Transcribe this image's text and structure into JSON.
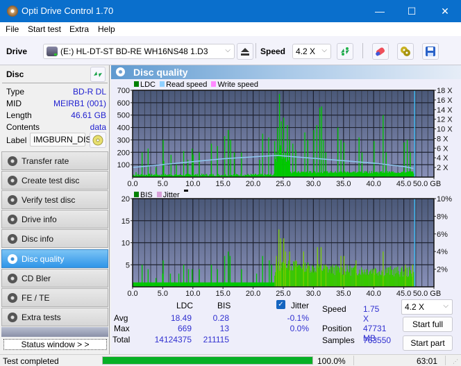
{
  "window": {
    "title": "Opti Drive Control 1.70",
    "minimize": "—",
    "maximize": "☐",
    "close": "✕"
  },
  "menu": [
    "File",
    "Start test",
    "Extra",
    "Help"
  ],
  "toolbar": {
    "drive_label": "Drive",
    "drive_value": "(E:)  HL-DT-ST BD-RE  WH16NS48 1.D3",
    "speed_label": "Speed",
    "speed_value": "4.2 X",
    "icons": [
      "eject-icon",
      "refresh-icon",
      "eraser-icon",
      "copy-icon",
      "save-icon"
    ]
  },
  "disc": {
    "header": "Disc",
    "rows": [
      {
        "key": "Type",
        "value": "BD-R DL"
      },
      {
        "key": "MID",
        "value": "MEIRB1 (001)"
      },
      {
        "key": "Length",
        "value": "46.61 GB"
      },
      {
        "key": "Contents",
        "value": "data"
      }
    ],
    "label_key": "Label",
    "label_value": "IMGBURN_DIS"
  },
  "nav": [
    {
      "label": "Transfer rate",
      "active": false
    },
    {
      "label": "Create test disc",
      "active": false
    },
    {
      "label": "Verify test disc",
      "active": false
    },
    {
      "label": "Drive info",
      "active": false
    },
    {
      "label": "Disc info",
      "active": false
    },
    {
      "label": "Disc quality",
      "active": true
    },
    {
      "label": "CD Bler",
      "active": false
    },
    {
      "label": "FE / TE",
      "active": false
    },
    {
      "label": "Extra tests",
      "active": false
    }
  ],
  "status_window_button": "Status window > >",
  "panel_title": "Disc quality",
  "colors": {
    "ldc": "#00c800",
    "bis": "#00c800",
    "read_speed": "#8fc8f0",
    "write_speed": "#ff66ff",
    "jitter": "#e0a0d8",
    "plot_bg_top": "#4a5878",
    "plot_bg_bottom": "#8890b8",
    "accent": "#0a6fcc"
  },
  "chart_data": [
    {
      "type": "bar",
      "title": "LDC / Read speed",
      "legend": [
        "LDC",
        "Read speed",
        "Write speed"
      ],
      "legend_position": "top-left",
      "xlabel": "GB",
      "x_ticks": [
        "0.0",
        "5.0",
        "10.0",
        "15.0",
        "20.0",
        "25.0",
        "30.0",
        "35.0",
        "40.0",
        "45.0",
        "50.0 GB"
      ],
      "xlim": [
        0,
        50
      ],
      "ylim": [
        0,
        700
      ],
      "y_ticks": [
        "100",
        "200",
        "300",
        "400",
        "500",
        "600",
        "700"
      ],
      "y2lim": [
        0,
        18
      ],
      "y2_ticks": [
        "2 X",
        "4 X",
        "6 X",
        "8 X",
        "10 X",
        "12 X",
        "14 X",
        "16 X",
        "18 X"
      ],
      "grid": true,
      "data_end_gb": 46.61,
      "ldc_spikes": [
        [
          0.5,
          40
        ],
        [
          1.5,
          200
        ],
        [
          2.5,
          230
        ],
        [
          3.8,
          80
        ],
        [
          5.0,
          300
        ],
        [
          5.1,
          130
        ],
        [
          6.3,
          180
        ],
        [
          7.2,
          100
        ],
        [
          8.4,
          210
        ],
        [
          9.1,
          140
        ],
        [
          9.8,
          230
        ],
        [
          10.0,
          180
        ],
        [
          11.0,
          200
        ],
        [
          13.0,
          270
        ],
        [
          14.0,
          250
        ],
        [
          15.2,
          330
        ],
        [
          15.8,
          380
        ],
        [
          16.2,
          300
        ],
        [
          16.8,
          200
        ],
        [
          18.0,
          200
        ],
        [
          21.0,
          140
        ],
        [
          21.5,
          350
        ],
        [
          22.5,
          320
        ],
        [
          23.5,
          290
        ],
        [
          24.0,
          400
        ],
        [
          24.3,
          670
        ],
        [
          24.6,
          450
        ],
        [
          25.0,
          480
        ],
        [
          25.6,
          420
        ],
        [
          26.0,
          300
        ],
        [
          26.5,
          270
        ],
        [
          27.0,
          220
        ],
        [
          28.5,
          360
        ],
        [
          29.0,
          300
        ],
        [
          30.0,
          380
        ],
        [
          30.5,
          420
        ],
        [
          31.0,
          560
        ],
        [
          31.3,
          570
        ],
        [
          31.6,
          300
        ],
        [
          32.0,
          200
        ],
        [
          34.0,
          400
        ],
        [
          34.5,
          300
        ],
        [
          35.0,
          280
        ],
        [
          37.5,
          320
        ],
        [
          38.0,
          200
        ],
        [
          40.0,
          290
        ],
        [
          41.5,
          500
        ],
        [
          42.0,
          200
        ],
        [
          45.0,
          280
        ],
        [
          45.5,
          300
        ],
        [
          46.0,
          200
        ]
      ],
      "ldc_baseline": 20,
      "read_speed_x": [
        [
          0,
          2.0
        ],
        [
          5,
          2.6
        ],
        [
          10,
          3.2
        ],
        [
          15,
          3.8
        ],
        [
          20,
          4.2
        ],
        [
          24,
          4.5
        ],
        [
          25,
          4.4
        ],
        [
          30,
          3.9
        ],
        [
          35,
          3.4
        ],
        [
          40,
          2.9
        ],
        [
          45,
          2.2
        ],
        [
          46.6,
          1.8
        ]
      ],
      "marker_gb": 46.8
    },
    {
      "type": "bar",
      "title": "BIS / Jitter",
      "legend": [
        "BIS",
        "Jitter"
      ],
      "legend_position": "top-left",
      "xlabel": "GB",
      "x_ticks": [
        "0.0",
        "5.0",
        "10.0",
        "15.0",
        "20.0",
        "25.0",
        "30.0",
        "35.0",
        "40.0",
        "45.0",
        "50.0 GB"
      ],
      "xlim": [
        0,
        50
      ],
      "ylim": [
        0,
        20
      ],
      "y_ticks": [
        "5",
        "10",
        "15",
        "20"
      ],
      "y2lim": [
        0,
        10
      ],
      "y2_ticks": [
        "2%",
        "4%",
        "6%",
        "8%",
        "10%"
      ],
      "grid": true,
      "data_end_gb": 46.61,
      "bis_spikes": [
        [
          1.5,
          5
        ],
        [
          2.5,
          4
        ],
        [
          3.8,
          2
        ],
        [
          5.0,
          6
        ],
        [
          4.9,
          3
        ],
        [
          6.2,
          3
        ],
        [
          7.6,
          3
        ],
        [
          8.4,
          5
        ],
        [
          9.2,
          4
        ],
        [
          9.8,
          4
        ],
        [
          11.0,
          4
        ],
        [
          13.0,
          5
        ],
        [
          14.0,
          4
        ],
        [
          15.2,
          7
        ],
        [
          15.8,
          8
        ],
        [
          16.1,
          7
        ],
        [
          18.0,
          4
        ],
        [
          20.5,
          3
        ],
        [
          21.5,
          7
        ],
        [
          22.6,
          6
        ],
        [
          23.0,
          5
        ],
        [
          23.8,
          7
        ],
        [
          24.2,
          13
        ],
        [
          24.5,
          11
        ],
        [
          25.0,
          11
        ],
        [
          25.3,
          8
        ],
        [
          26.0,
          8
        ],
        [
          27.0,
          6
        ],
        [
          28.3,
          8
        ],
        [
          29.0,
          5
        ],
        [
          30.6,
          9
        ],
        [
          31.2,
          9
        ],
        [
          32.0,
          5
        ],
        [
          34.5,
          7
        ],
        [
          35.0,
          7
        ],
        [
          37.0,
          6
        ],
        [
          40.0,
          4
        ],
        [
          41.5,
          8
        ],
        [
          45.2,
          5
        ],
        [
          46.4,
          5
        ]
      ],
      "bis_level_profile": [
        [
          0,
          1
        ],
        [
          23.5,
          1
        ],
        [
          23.8,
          4
        ],
        [
          28,
          4
        ],
        [
          30,
          3.5
        ],
        [
          35,
          3
        ],
        [
          40,
          3
        ],
        [
          46.61,
          2.5
        ]
      ]
    }
  ],
  "stats": {
    "col_ldc": "LDC",
    "col_bis": "BIS",
    "rows": [
      {
        "label": "Avg",
        "ldc": "18.49",
        "bis": "0.28"
      },
      {
        "label": "Max",
        "ldc": "669",
        "bis": "13"
      },
      {
        "label": "Total",
        "ldc": "14124375",
        "bis": "211115"
      }
    ],
    "jitter_label": "Jitter",
    "jitter_checked": true,
    "jitter_avg": "-0.1%",
    "jitter_max": "0.0%",
    "speed_label": "Speed",
    "speed_value": "1.75 X",
    "position_label": "Position",
    "position_value": "47731 MB",
    "samples_label": "Samples",
    "samples_value": "763550",
    "speed_select": "4.2 X",
    "start_full": "Start full",
    "start_part": "Start part"
  },
  "statusbar": {
    "text": "Test completed",
    "progress_percent": 100.0,
    "progress_text": "100.0%",
    "time": "63:01"
  }
}
